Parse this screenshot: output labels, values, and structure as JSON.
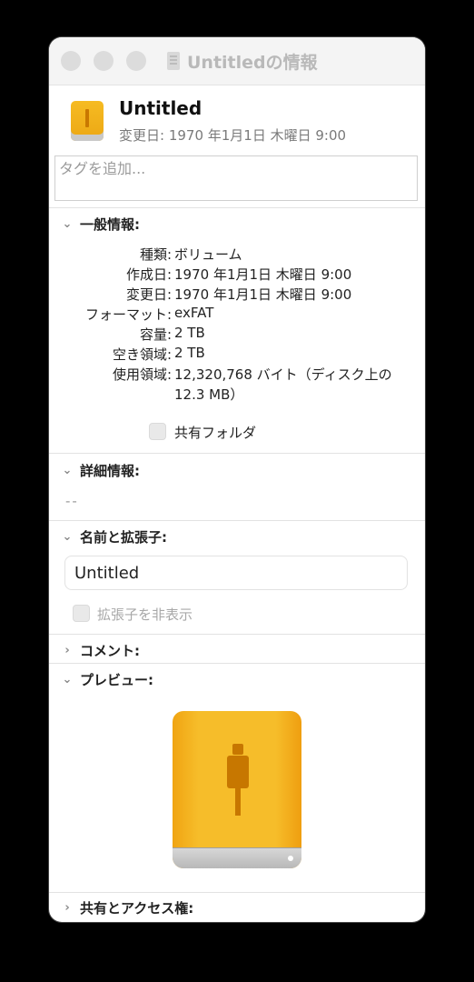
{
  "window": {
    "title": "Untitledの情報"
  },
  "header": {
    "name": "Untitled",
    "modified": "変更日: 1970 年1月1日 木曜日 9:00"
  },
  "tags": {
    "placeholder": "タグを追加..."
  },
  "general": {
    "heading": "一般情報:",
    "rows": [
      {
        "label": "種類:",
        "value": "ボリューム"
      },
      {
        "label": "作成日:",
        "value": "1970 年1月1日 木曜日 9:00"
      },
      {
        "label": "変更日:",
        "value": "1970 年1月1日 木曜日 9:00"
      },
      {
        "label": "フォーマット:",
        "value": "exFAT"
      },
      {
        "label": "容量:",
        "value": "2 TB"
      },
      {
        "label": "空き領域:",
        "value": "2 TB"
      },
      {
        "label": "使用領域:",
        "value": "12,320,768 バイト（ディスク上の 12.3 MB）"
      }
    ],
    "shared_folder_label": "共有フォルダ"
  },
  "details": {
    "heading": "詳細情報:",
    "value": "--"
  },
  "name_ext": {
    "heading": "名前と拡張子:",
    "value": "Untitled",
    "hide_ext_label": "拡張子を非表示"
  },
  "comments": {
    "heading": "コメント:"
  },
  "preview": {
    "heading": "プレビュー:"
  },
  "sharing": {
    "heading": "共有とアクセス権:"
  },
  "icons": {
    "drive": "external-drive-icon",
    "document": "document-icon",
    "chevron_down": "chevron-down-icon",
    "chevron_right": "chevron-right-icon"
  },
  "colors": {
    "drive_yellow": "#F6BD2A",
    "drive_plug": "#C77700"
  }
}
